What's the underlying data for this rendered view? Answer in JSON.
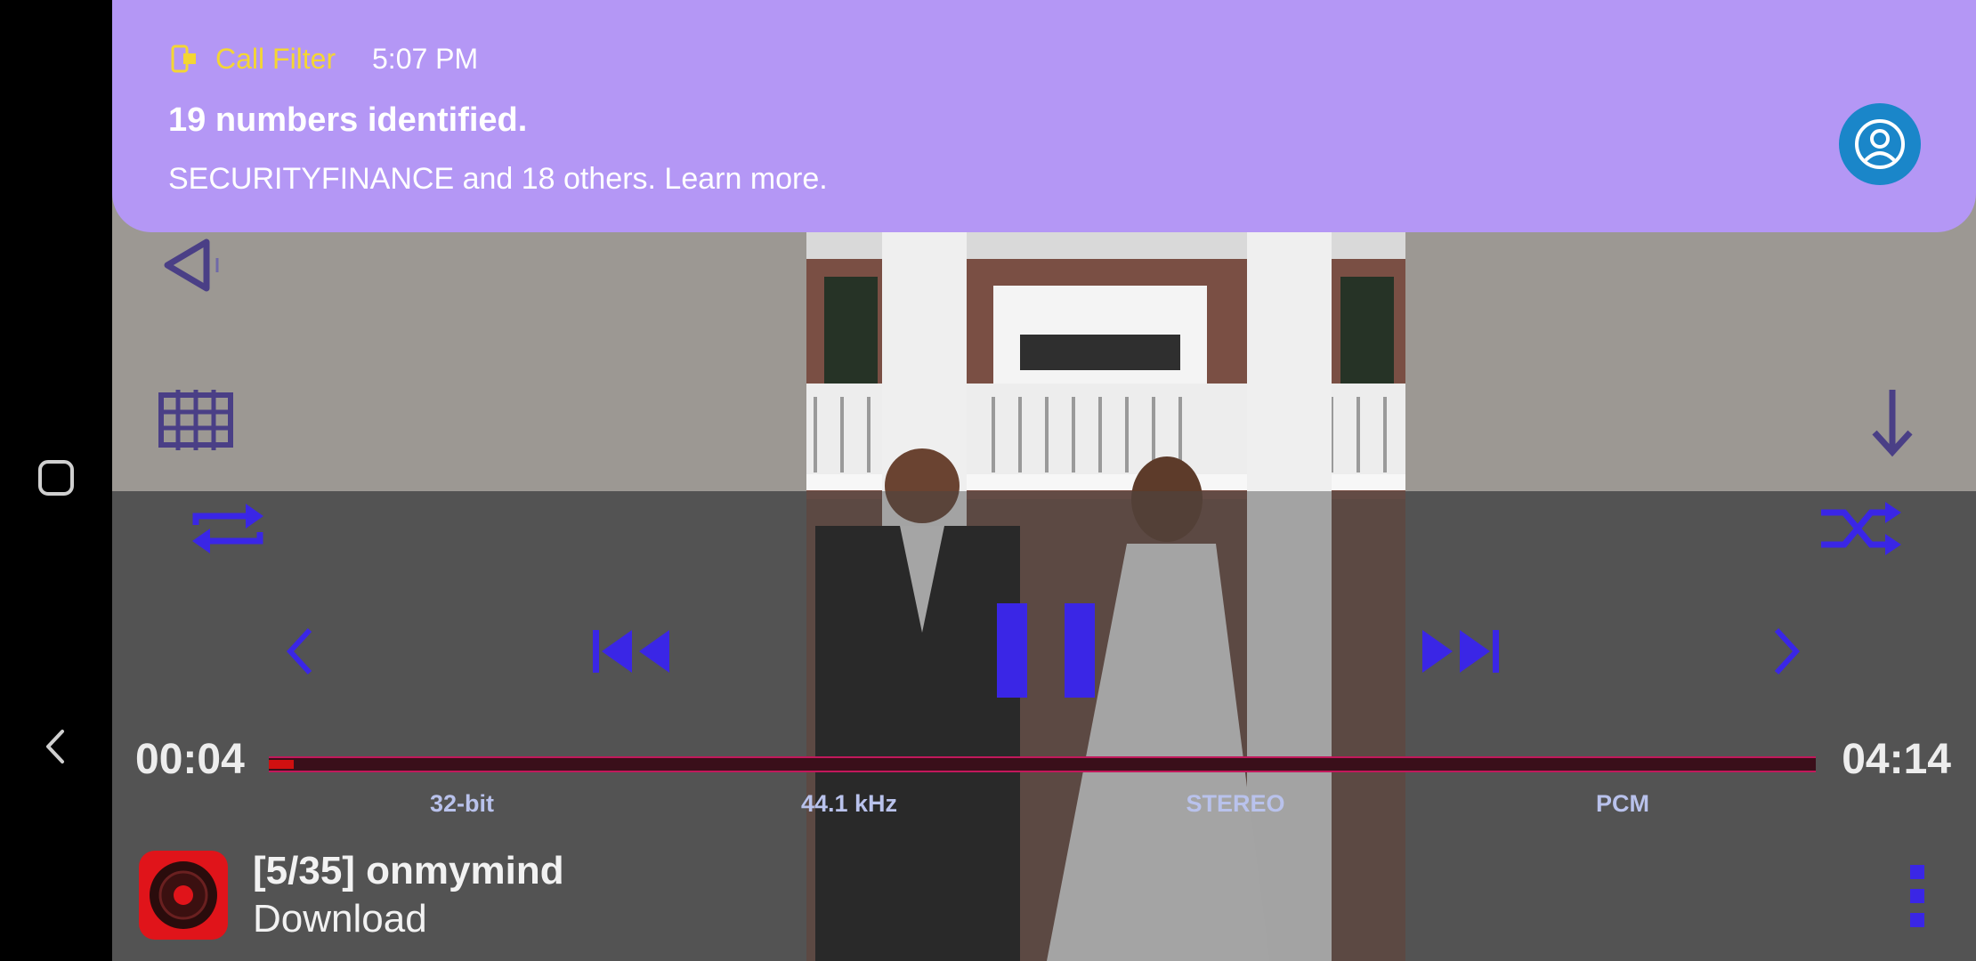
{
  "system_nav": {
    "home_icon": "square-home-icon",
    "back_icon": "back-arrow-icon"
  },
  "notification": {
    "app_name": "Call Filter",
    "time": "5:07 PM",
    "title": "19 numbers identified.",
    "body": "SECURITYFINANCE and 18 others. Learn more.",
    "app_color": "#f4d633",
    "background_color": "#b497f5",
    "avatar_icon": "account-circle-icon"
  },
  "player": {
    "controls": {
      "volume_icon": "speaker-icon",
      "equalizer_icon": "grid-icon",
      "download_icon": "down-arrow-icon",
      "repeat_icon": "repeat-icon",
      "shuffle_icon": "shuffle-icon",
      "prev_page_icon": "chevron-left-icon",
      "rewind_icon": "skip-previous-icon",
      "pause_icon": "pause-icon",
      "forward_icon": "skip-next-icon",
      "next_page_icon": "chevron-right-icon",
      "accent_color": "#3a26e6"
    },
    "progress": {
      "elapsed": "00:04",
      "duration": "04:14",
      "fraction": 0.016
    },
    "format": {
      "bit_depth": "32-bit",
      "sample_rate": "44.1 kHz",
      "channels": "STEREO",
      "codec": "PCM"
    },
    "track": {
      "title": "[5/35] onmymind",
      "subtitle": "Download",
      "app_icon": "speaker-app-icon",
      "menu_icon": "more-vert-icon"
    }
  }
}
